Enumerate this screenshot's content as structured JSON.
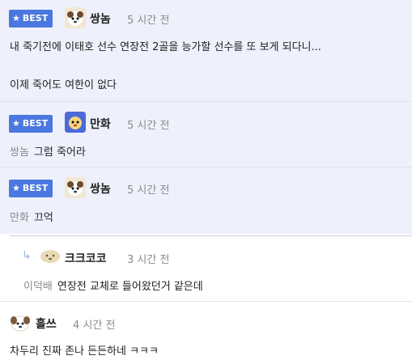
{
  "badge_label": "BEST",
  "comments": [
    {
      "nick": "쌍놈",
      "time": "5 시간 전",
      "lines": [
        "내 죽기전에 이태호 선수 연장전 2골을 능가할 선수를 또 보게 되다니...",
        "이제 죽어도 여한이 없다"
      ]
    },
    {
      "nick": "만화",
      "time": "5 시간 전",
      "mention": "쌍놈",
      "text": "그럼 죽어라"
    },
    {
      "nick": "쌍놈",
      "time": "5 시간 전",
      "mention": "만화",
      "text": "끄억"
    },
    {
      "nick": "크크코코",
      "time": "3 시간 전",
      "mention": "이덕배",
      "text": "연장전 교체로 들어왔던거 같은데"
    },
    {
      "nick": "흘쓰",
      "time": "4 시간 전",
      "text": "차두리 진짜 존나 든든하네 ㅋㅋㅋ"
    }
  ]
}
